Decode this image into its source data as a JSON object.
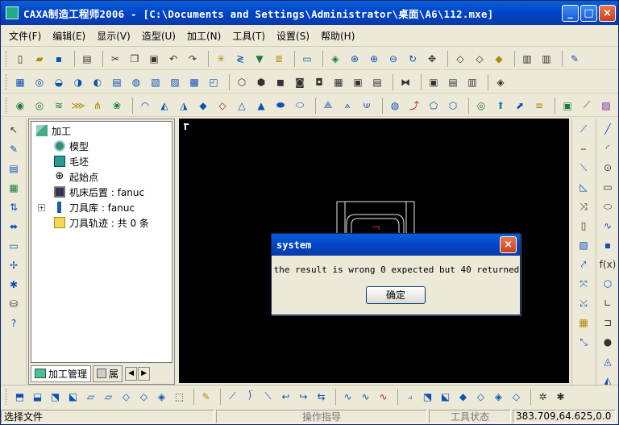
{
  "window": {
    "title": "CAXA制造工程师2006  - [C:\\Documents and Settings\\Administrator\\桌面\\A6\\112.mxe]",
    "min": "_",
    "max": "□",
    "close": "×"
  },
  "menu": [
    "文件(F)",
    "编辑(E)",
    "显示(V)",
    "造型(U)",
    "加工(N)",
    "工具(T)",
    "设置(S)",
    "帮助(H)"
  ],
  "tree": {
    "root": "加工",
    "items": [
      {
        "label": "模型",
        "icon": "model-icon"
      },
      {
        "label": "毛坯",
        "icon": "stock-icon"
      },
      {
        "label": "起始点",
        "icon": "start-point-icon"
      },
      {
        "label": "机床后置 : fanuc",
        "icon": "machine-post-icon"
      },
      {
        "label": "刀具库 : fanuc",
        "icon": "tool-library-icon"
      },
      {
        "label": "刀具轨迹 : 共 0 条",
        "icon": "toolpath-folder-icon"
      }
    ],
    "expand_symbol": "+",
    "tabs": [
      {
        "label": "加工管理"
      },
      {
        "label": "属"
      }
    ],
    "scroll_left": "◀",
    "scroll_right": "▶"
  },
  "dialog": {
    "title": "system",
    "message": "the result is wrong 0 expected but 40 returned",
    "ok": "确定",
    "close": "×"
  },
  "status": {
    "left": "选择文件",
    "guide": "操作指导",
    "tool": "工具状态",
    "coords": "383.709,64.625,0.0"
  },
  "colors": {
    "title_bar": "#0a4fd0",
    "viewport": "#000000",
    "workspace": "#ece9d8"
  }
}
